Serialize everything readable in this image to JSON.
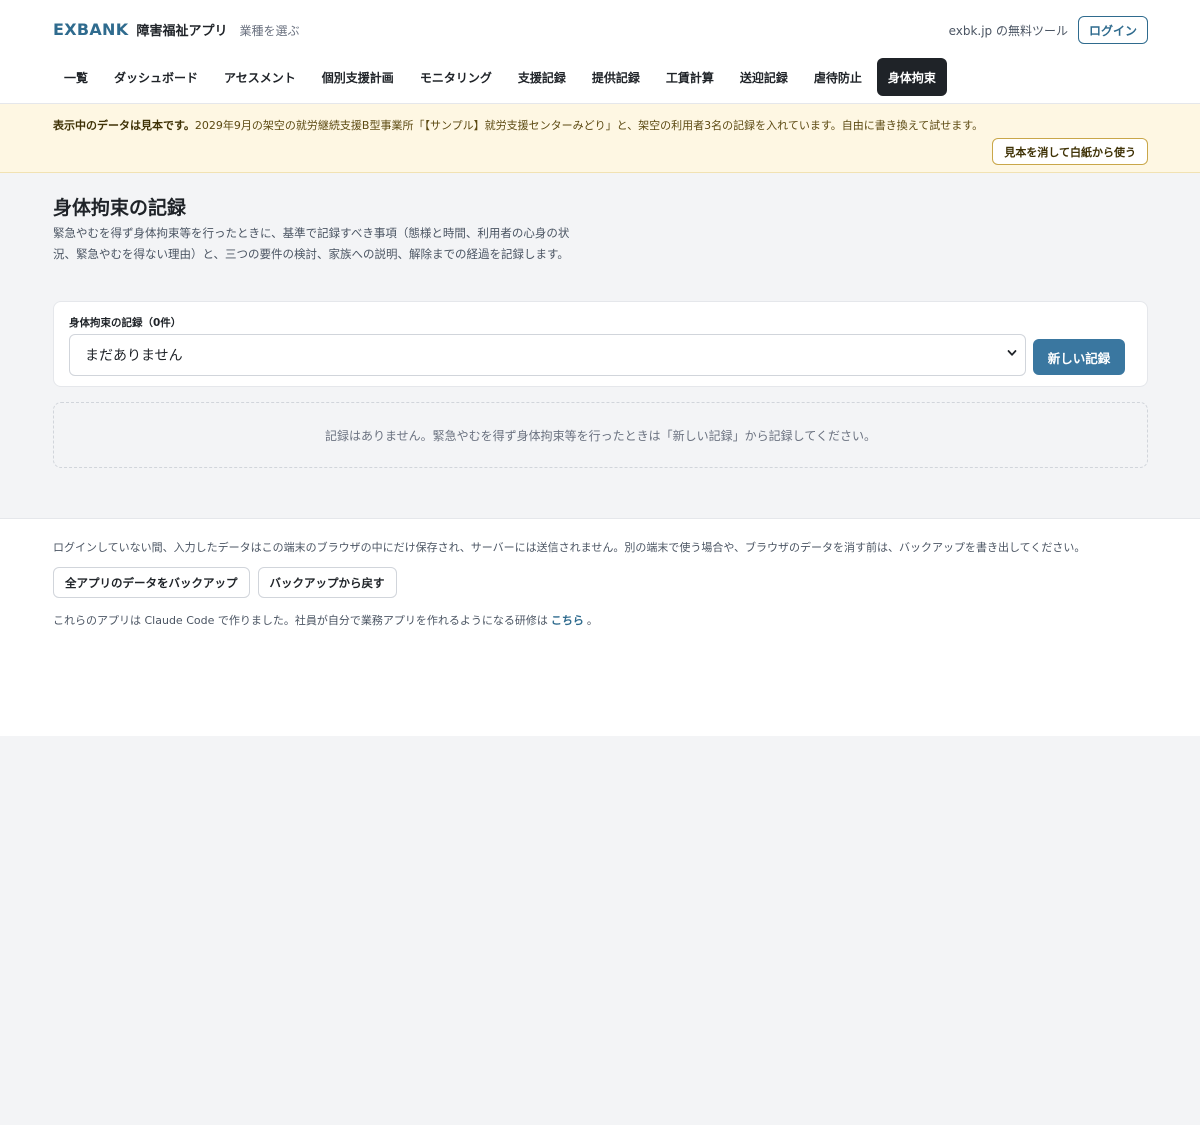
{
  "header": {
    "logo": "EXBANK",
    "app_name": "障害福祉アプリ",
    "industry_link": "業種を選ぶ",
    "tools_link": "exbk.jp の無料ツール",
    "login_label": "ログイン"
  },
  "nav": {
    "tabs": [
      {
        "label": "一覧",
        "active": false
      },
      {
        "label": "ダッシュボード",
        "active": false
      },
      {
        "label": "アセスメント",
        "active": false
      },
      {
        "label": "個別支援計画",
        "active": false
      },
      {
        "label": "モニタリング",
        "active": false
      },
      {
        "label": "支援記録",
        "active": false
      },
      {
        "label": "提供記録",
        "active": false
      },
      {
        "label": "工賃計算",
        "active": false
      },
      {
        "label": "送迎記録",
        "active": false
      },
      {
        "label": "虐待防止",
        "active": false
      },
      {
        "label": "身体拘束",
        "active": true
      }
    ]
  },
  "notice": {
    "strong": "表示中のデータは見本です。",
    "text": "2029年9月の架空の就労継続支援B型事業所「【サンプル】就労支援センターみどり」と、架空の利用者3名の記録を入れています。自由に書き換えて試せます。",
    "clear_button": "見本を消して白紙から使う"
  },
  "main": {
    "title": "身体拘束の記録",
    "description": "緊急やむを得ず身体拘束等を行ったときに、基準で記録すべき事項（態様と時間、利用者の心身の状況、緊急やむを得ない理由）と、三つの要件の検討、家族への説明、解除までの経過を記録します。",
    "record_label": "身体拘束の記録（0件）",
    "select_value": "まだありません",
    "new_button": "新しい記録",
    "empty_message": "記録はありません。緊急やむを得ず身体拘束等を行ったときは「新しい記録」から記録してください。"
  },
  "footer": {
    "note": "ログインしていない間、入力したデータはこの端末のブラウザの中にだけ保存され、サーバーには送信されません。別の端末で使う場合や、ブラウザのデータを消す前は、バックアップを書き出してください。",
    "backup_button": "全アプリのデータをバックアップ",
    "restore_button": "バックアップから戻す",
    "credit_prefix": "これらのアプリは Claude Code で作りました。社員が自分で業務アプリを作れるようになる研修は",
    "credit_link": "こちら",
    "credit_suffix": "。"
  },
  "colors": {
    "brand": "#2f6b8e",
    "primary_button": "#3a77a0",
    "active_tab": "#1f2328",
    "notice_bg": "#fef7e3"
  }
}
